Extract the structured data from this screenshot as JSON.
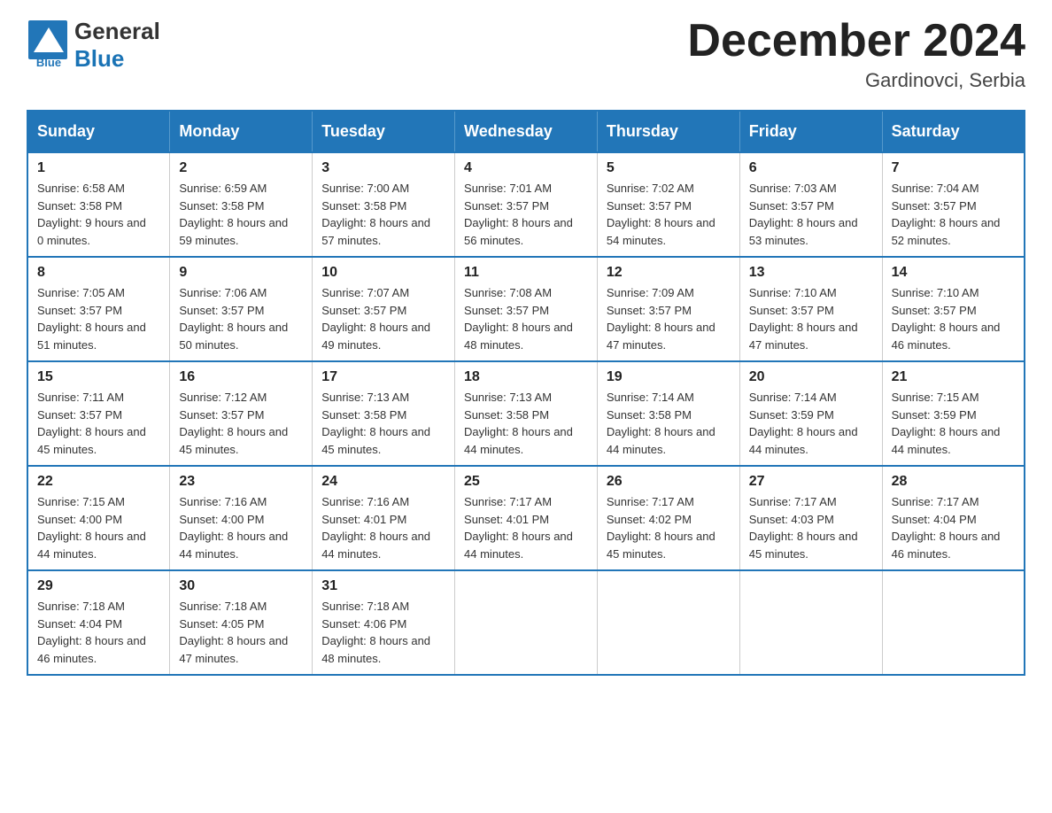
{
  "header": {
    "logo": {
      "text_general": "General",
      "text_blue": "Blue"
    },
    "title": "December 2024",
    "location": "Gardinovci, Serbia"
  },
  "calendar": {
    "days_of_week": [
      "Sunday",
      "Monday",
      "Tuesday",
      "Wednesday",
      "Thursday",
      "Friday",
      "Saturday"
    ],
    "weeks": [
      [
        {
          "day": "1",
          "sunrise": "6:58 AM",
          "sunset": "3:58 PM",
          "daylight": "9 hours and 0 minutes."
        },
        {
          "day": "2",
          "sunrise": "6:59 AM",
          "sunset": "3:58 PM",
          "daylight": "8 hours and 59 minutes."
        },
        {
          "day": "3",
          "sunrise": "7:00 AM",
          "sunset": "3:58 PM",
          "daylight": "8 hours and 57 minutes."
        },
        {
          "day": "4",
          "sunrise": "7:01 AM",
          "sunset": "3:57 PM",
          "daylight": "8 hours and 56 minutes."
        },
        {
          "day": "5",
          "sunrise": "7:02 AM",
          "sunset": "3:57 PM",
          "daylight": "8 hours and 54 minutes."
        },
        {
          "day": "6",
          "sunrise": "7:03 AM",
          "sunset": "3:57 PM",
          "daylight": "8 hours and 53 minutes."
        },
        {
          "day": "7",
          "sunrise": "7:04 AM",
          "sunset": "3:57 PM",
          "daylight": "8 hours and 52 minutes."
        }
      ],
      [
        {
          "day": "8",
          "sunrise": "7:05 AM",
          "sunset": "3:57 PM",
          "daylight": "8 hours and 51 minutes."
        },
        {
          "day": "9",
          "sunrise": "7:06 AM",
          "sunset": "3:57 PM",
          "daylight": "8 hours and 50 minutes."
        },
        {
          "day": "10",
          "sunrise": "7:07 AM",
          "sunset": "3:57 PM",
          "daylight": "8 hours and 49 minutes."
        },
        {
          "day": "11",
          "sunrise": "7:08 AM",
          "sunset": "3:57 PM",
          "daylight": "8 hours and 48 minutes."
        },
        {
          "day": "12",
          "sunrise": "7:09 AM",
          "sunset": "3:57 PM",
          "daylight": "8 hours and 47 minutes."
        },
        {
          "day": "13",
          "sunrise": "7:10 AM",
          "sunset": "3:57 PM",
          "daylight": "8 hours and 47 minutes."
        },
        {
          "day": "14",
          "sunrise": "7:10 AM",
          "sunset": "3:57 PM",
          "daylight": "8 hours and 46 minutes."
        }
      ],
      [
        {
          "day": "15",
          "sunrise": "7:11 AM",
          "sunset": "3:57 PM",
          "daylight": "8 hours and 45 minutes."
        },
        {
          "day": "16",
          "sunrise": "7:12 AM",
          "sunset": "3:57 PM",
          "daylight": "8 hours and 45 minutes."
        },
        {
          "day": "17",
          "sunrise": "7:13 AM",
          "sunset": "3:58 PM",
          "daylight": "8 hours and 45 minutes."
        },
        {
          "day": "18",
          "sunrise": "7:13 AM",
          "sunset": "3:58 PM",
          "daylight": "8 hours and 44 minutes."
        },
        {
          "day": "19",
          "sunrise": "7:14 AM",
          "sunset": "3:58 PM",
          "daylight": "8 hours and 44 minutes."
        },
        {
          "day": "20",
          "sunrise": "7:14 AM",
          "sunset": "3:59 PM",
          "daylight": "8 hours and 44 minutes."
        },
        {
          "day": "21",
          "sunrise": "7:15 AM",
          "sunset": "3:59 PM",
          "daylight": "8 hours and 44 minutes."
        }
      ],
      [
        {
          "day": "22",
          "sunrise": "7:15 AM",
          "sunset": "4:00 PM",
          "daylight": "8 hours and 44 minutes."
        },
        {
          "day": "23",
          "sunrise": "7:16 AM",
          "sunset": "4:00 PM",
          "daylight": "8 hours and 44 minutes."
        },
        {
          "day": "24",
          "sunrise": "7:16 AM",
          "sunset": "4:01 PM",
          "daylight": "8 hours and 44 minutes."
        },
        {
          "day": "25",
          "sunrise": "7:17 AM",
          "sunset": "4:01 PM",
          "daylight": "8 hours and 44 minutes."
        },
        {
          "day": "26",
          "sunrise": "7:17 AM",
          "sunset": "4:02 PM",
          "daylight": "8 hours and 45 minutes."
        },
        {
          "day": "27",
          "sunrise": "7:17 AM",
          "sunset": "4:03 PM",
          "daylight": "8 hours and 45 minutes."
        },
        {
          "day": "28",
          "sunrise": "7:17 AM",
          "sunset": "4:04 PM",
          "daylight": "8 hours and 46 minutes."
        }
      ],
      [
        {
          "day": "29",
          "sunrise": "7:18 AM",
          "sunset": "4:04 PM",
          "daylight": "8 hours and 46 minutes."
        },
        {
          "day": "30",
          "sunrise": "7:18 AM",
          "sunset": "4:05 PM",
          "daylight": "8 hours and 47 minutes."
        },
        {
          "day": "31",
          "sunrise": "7:18 AM",
          "sunset": "4:06 PM",
          "daylight": "8 hours and 48 minutes."
        },
        null,
        null,
        null,
        null
      ]
    ]
  }
}
